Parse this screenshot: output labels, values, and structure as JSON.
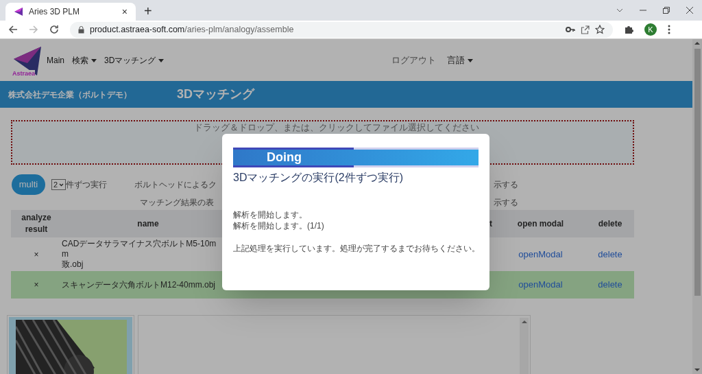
{
  "browser": {
    "tab_title": "Aries 3D PLM",
    "tab_close": "×",
    "new_tab": "+",
    "url_host": "product.astraea-soft.com",
    "url_path": "/aries-plm/analogy/assemble",
    "profile_initial": "K"
  },
  "navbar": {
    "logo_text": "Astraea",
    "items": [
      {
        "label": "Main",
        "dropdown": false
      },
      {
        "label": "検索",
        "dropdown": true
      },
      {
        "label": "3Dマッチング",
        "dropdown": true
      }
    ],
    "right_items": [
      {
        "label": "ログアウト",
        "dropdown": false
      },
      {
        "label": "言語",
        "dropdown": true
      }
    ]
  },
  "header": {
    "company": "株式会社デモ企業（ボルトデモ）",
    "title": "3Dマッチング"
  },
  "drop_zone": {
    "text": "ドラッグ＆ドロップ、または、クリックしてファイル選択してください"
  },
  "controls": {
    "button": "multi",
    "select_value": "2",
    "select_suffix": "件ずつ実行"
  },
  "options": [
    {
      "left": "ボルトヘッドによるク",
      "right": "示する"
    },
    {
      "left": "マッチング結果の表",
      "right": "示する"
    }
  ],
  "table": {
    "columns": [
      "analyze result",
      "name",
      "t",
      "open modal",
      "delete"
    ],
    "rows": [
      {
        "result": "×",
        "name_lines": [
          "CADデータサラマイナス穴ボルトM5-10mm",
          "致.obj"
        ],
        "open": "openModal",
        "delete": "delete",
        "selected": false
      },
      {
        "result": "×",
        "name_lines": [
          "スキャンデータ六角ボルトM12-40mm.obj"
        ],
        "open": "openModal",
        "delete": "delete",
        "selected": true
      }
    ]
  },
  "modal": {
    "banner": "Doing",
    "title": "3Dマッチングの実行(2件ずつ実行)",
    "lines": [
      "解析を開始します。",
      "解析を開始します。(1/1)"
    ],
    "note": "上記処理を実行しています。処理が完了するまでお待ちください。"
  }
}
